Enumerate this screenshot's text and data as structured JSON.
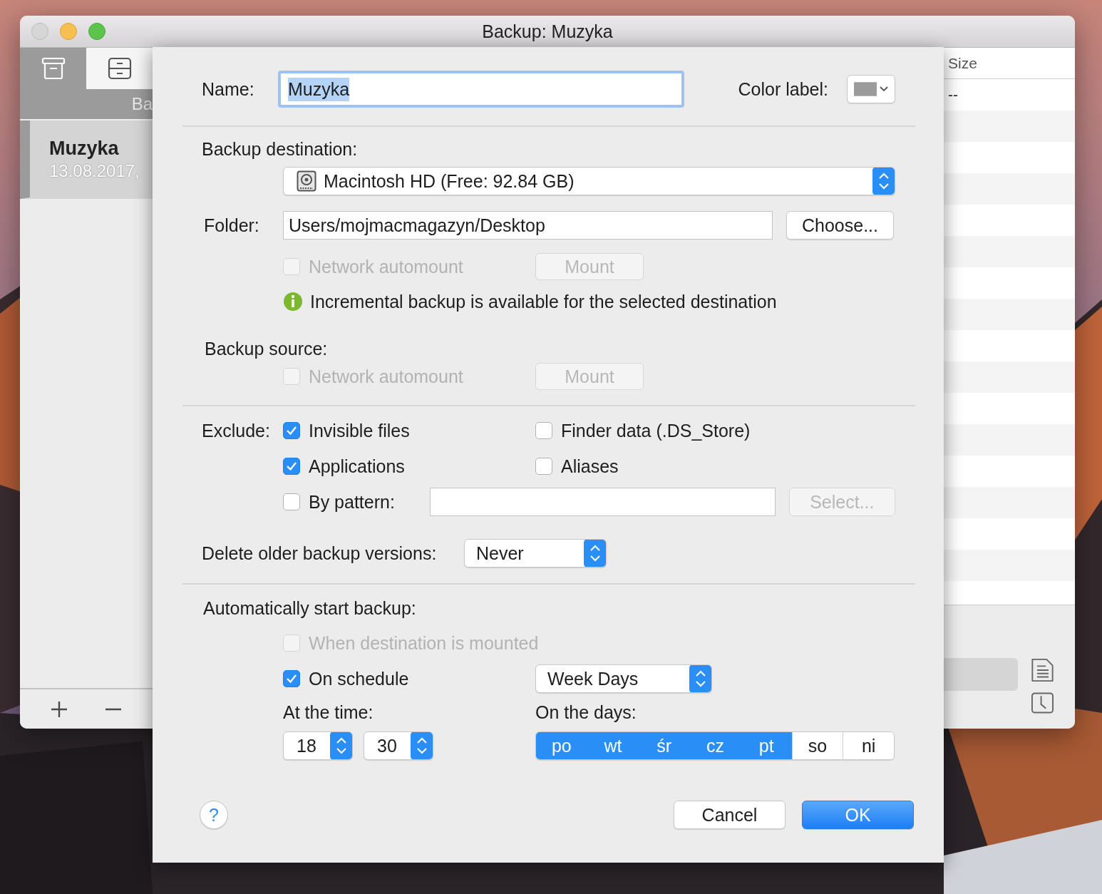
{
  "window": {
    "title": "Backup: Muzyka"
  },
  "sidebar": {
    "tabs": [
      {
        "kind": "archive",
        "selected": true
      },
      {
        "kind": "drawer",
        "selected": false
      }
    ],
    "section_label": "Ba",
    "items": [
      {
        "name": "Muzyka",
        "date": "13.08.2017,",
        "selected": true
      }
    ]
  },
  "table": {
    "columns": [
      "Size"
    ],
    "rows": [
      [
        "--"
      ]
    ]
  },
  "sheet": {
    "name": {
      "label": "Name:",
      "value": "Muzyka",
      "text_selected": true
    },
    "color_label": {
      "label": "Color label:"
    },
    "destination": {
      "heading": "Backup destination:",
      "disk": "Macintosh HD (Free: 92.84 GB)",
      "folder_label": "Folder:",
      "folder": "Users/mojmacmagazyn/Desktop",
      "choose": "Choose...",
      "automount": {
        "label": "Network automount",
        "checked": false,
        "disabled": true
      },
      "mount": {
        "label": "Mount",
        "disabled": true
      },
      "info": "Incremental backup is available for the selected destination"
    },
    "source": {
      "heading": "Backup source:",
      "automount": {
        "label": "Network automount",
        "checked": false,
        "disabled": true
      },
      "mount": {
        "label": "Mount",
        "disabled": true
      }
    },
    "exclude": {
      "label": "Exclude:",
      "options": [
        {
          "label": "Invisible files",
          "checked": true
        },
        {
          "label": "Finder data (.DS_Store)",
          "checked": false
        },
        {
          "label": "Applications",
          "checked": true
        },
        {
          "label": "Aliases",
          "checked": false
        }
      ],
      "pattern": {
        "label": "By pattern:",
        "checked": false
      },
      "select": {
        "label": "Select...",
        "disabled": true
      }
    },
    "delete_older": {
      "label": "Delete older backup versions:",
      "value": "Never"
    },
    "auto_start": {
      "heading": "Automatically start backup:",
      "when_mounted": {
        "label": "When destination is mounted",
        "checked": false,
        "disabled": true
      },
      "schedule": {
        "label": "On schedule",
        "checked": true
      },
      "frequency": "Week Days",
      "time_label": "At the time:",
      "hour": "18",
      "minute": "30",
      "days_label": "On the days:",
      "days": [
        {
          "label": "po",
          "selected": true
        },
        {
          "label": "wt",
          "selected": true
        },
        {
          "label": "śr",
          "selected": true
        },
        {
          "label": "cz",
          "selected": true
        },
        {
          "label": "pt",
          "selected": true
        },
        {
          "label": "so",
          "selected": false
        },
        {
          "label": "ni",
          "selected": false
        }
      ]
    },
    "buttons": {
      "help": "?",
      "cancel": "Cancel",
      "ok": "OK"
    }
  }
}
